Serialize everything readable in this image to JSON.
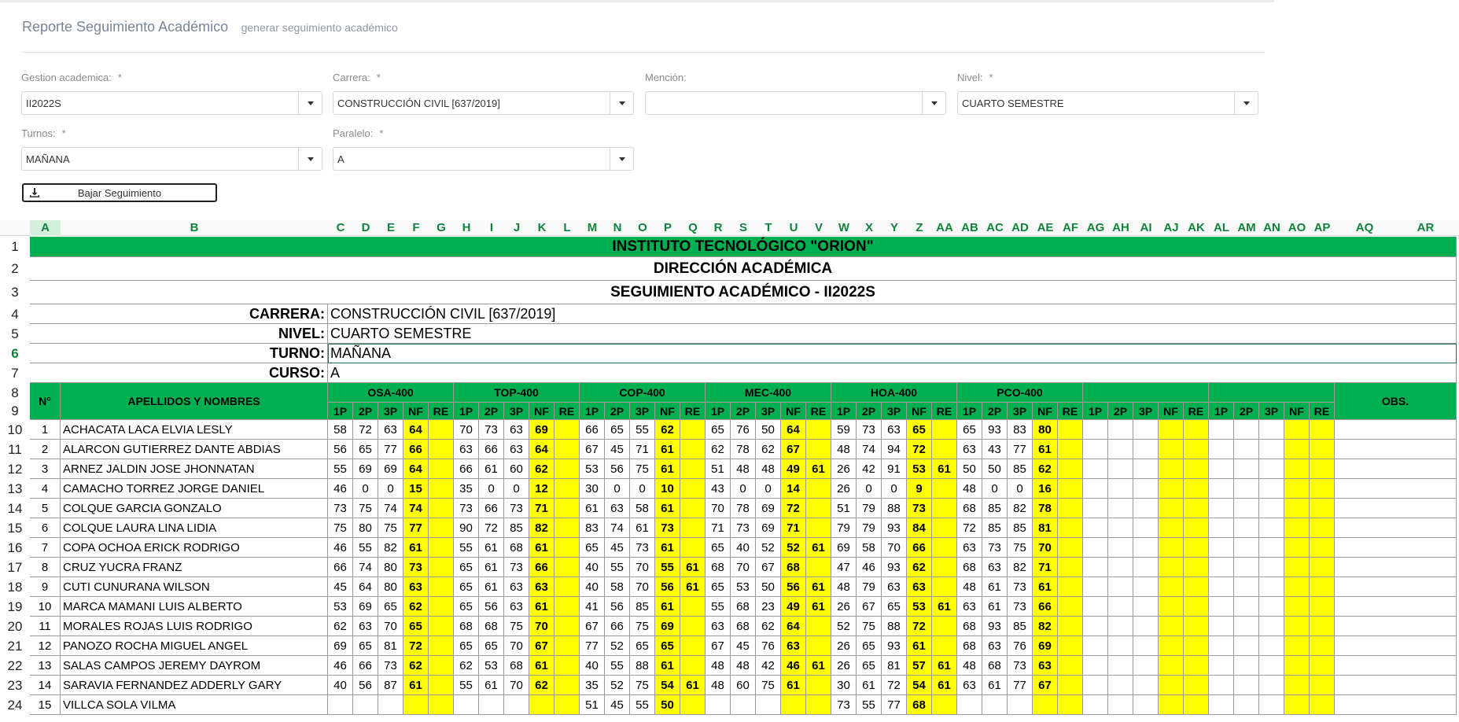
{
  "header": {
    "title": "Reporte Seguimiento Académico",
    "subtitle": "generar seguimiento académico"
  },
  "filters": {
    "gestion": {
      "label": "Gestion academica:",
      "required": "*",
      "value": "II2022S"
    },
    "carrera": {
      "label": "Carrera:",
      "required": "*",
      "value": "CONSTRUCCIÓN CIVIL [637/2019]"
    },
    "mencion": {
      "label": "Mención:",
      "required": "",
      "value": ""
    },
    "nivel": {
      "label": "Nivel:",
      "required": "*",
      "value": "CUARTO SEMESTRE"
    },
    "turnos": {
      "label": "Turnos:",
      "required": "*",
      "value": "MAÑANA"
    },
    "paralelo": {
      "label": "Paralelo:",
      "required": "*",
      "value": "A"
    }
  },
  "download_button": {
    "label": "Bajar Seguimiento",
    "icon": "download-icon"
  },
  "colors": {
    "green": "#00b050",
    "yellow": "#ffff00",
    "header_text": "#11823b"
  },
  "sheet": {
    "column_letters": [
      "A",
      "B",
      "C",
      "D",
      "E",
      "F",
      "G",
      "H",
      "I",
      "J",
      "K",
      "L",
      "M",
      "N",
      "O",
      "P",
      "Q",
      "R",
      "S",
      "T",
      "U",
      "V",
      "W",
      "X",
      "Y",
      "Z",
      "AA",
      "AB",
      "AC",
      "AD",
      "AE",
      "AF",
      "AG",
      "AH",
      "AI",
      "AJ",
      "AK",
      "AL",
      "AM",
      "AN",
      "AO",
      "AP",
      "AQ",
      "AR"
    ],
    "row_numbers": [
      "1",
      "2",
      "3",
      "4",
      "5",
      "6",
      "7",
      "8",
      "9",
      "10",
      "11",
      "12",
      "13",
      "14",
      "15",
      "16",
      "17",
      "18",
      "19",
      "20",
      "21",
      "22",
      "23",
      "24"
    ],
    "title1": "INSTITUTO TECNOLÓGICO  \"ORION\"",
    "title2": "DIRECCIÓN ACADÉMICA",
    "title3": "SEGUIMIENTO ACADÉMICO - II2022S",
    "info": [
      {
        "label": "CARRERA:",
        "value": "CONSTRUCCIÓN CIVIL [637/2019]"
      },
      {
        "label": "NIVEL:",
        "value": "CUARTO SEMESTRE"
      },
      {
        "label": "TURNO:",
        "value": "MAÑANA"
      },
      {
        "label": "CURSO:",
        "value": "A"
      }
    ],
    "col_no": "N°",
    "col_name": "APELLIDOS Y NOMBRES",
    "col_obs": "OBS.",
    "subjects": [
      "OSA-400",
      "TOP-400",
      "COP-400",
      "MEC-400",
      "HOA-400",
      "PCO-400",
      "",
      ""
    ],
    "sub_columns": [
      "1P",
      "2P",
      "3P",
      "NF",
      "RE"
    ],
    "students": [
      {
        "n": "1",
        "name": "ACHACATA LACA ELVIA LESLY",
        "g": [
          [
            "58",
            "72",
            "63",
            "64",
            ""
          ],
          [
            "70",
            "73",
            "63",
            "69",
            ""
          ],
          [
            "66",
            "65",
            "55",
            "62",
            ""
          ],
          [
            "65",
            "76",
            "50",
            "64",
            ""
          ],
          [
            "59",
            "73",
            "63",
            "65",
            ""
          ],
          [
            "65",
            "93",
            "83",
            "80",
            ""
          ]
        ]
      },
      {
        "n": "2",
        "name": "ALARCON GUTIERREZ DANTE ABDIAS",
        "g": [
          [
            "56",
            "65",
            "77",
            "66",
            ""
          ],
          [
            "63",
            "66",
            "63",
            "64",
            ""
          ],
          [
            "67",
            "45",
            "71",
            "61",
            ""
          ],
          [
            "62",
            "78",
            "62",
            "67",
            ""
          ],
          [
            "48",
            "74",
            "94",
            "72",
            ""
          ],
          [
            "63",
            "43",
            "77",
            "61",
            ""
          ]
        ]
      },
      {
        "n": "3",
        "name": "ARNEZ JALDIN JOSE JHONNATAN",
        "g": [
          [
            "55",
            "69",
            "69",
            "64",
            ""
          ],
          [
            "66",
            "61",
            "60",
            "62",
            ""
          ],
          [
            "53",
            "56",
            "75",
            "61",
            ""
          ],
          [
            "51",
            "48",
            "48",
            "49",
            "61"
          ],
          [
            "26",
            "42",
            "91",
            "53",
            "61"
          ],
          [
            "50",
            "50",
            "85",
            "62",
            ""
          ]
        ]
      },
      {
        "n": "4",
        "name": "CAMACHO TORREZ JORGE DANIEL",
        "g": [
          [
            "46",
            "0",
            "0",
            "15",
            ""
          ],
          [
            "35",
            "0",
            "0",
            "12",
            ""
          ],
          [
            "30",
            "0",
            "0",
            "10",
            ""
          ],
          [
            "43",
            "0",
            "0",
            "14",
            ""
          ],
          [
            "26",
            "0",
            "0",
            "9",
            ""
          ],
          [
            "48",
            "0",
            "0",
            "16",
            ""
          ]
        ]
      },
      {
        "n": "5",
        "name": "COLQUE GARCIA GONZALO",
        "g": [
          [
            "73",
            "75",
            "74",
            "74",
            ""
          ],
          [
            "73",
            "66",
            "73",
            "71",
            ""
          ],
          [
            "61",
            "63",
            "58",
            "61",
            ""
          ],
          [
            "70",
            "78",
            "69",
            "72",
            ""
          ],
          [
            "51",
            "79",
            "88",
            "73",
            ""
          ],
          [
            "68",
            "85",
            "82",
            "78",
            ""
          ]
        ]
      },
      {
        "n": "6",
        "name": "COLQUE LAURA LINA LIDIA",
        "g": [
          [
            "75",
            "80",
            "75",
            "77",
            ""
          ],
          [
            "90",
            "72",
            "85",
            "82",
            ""
          ],
          [
            "83",
            "74",
            "61",
            "73",
            ""
          ],
          [
            "71",
            "73",
            "69",
            "71",
            ""
          ],
          [
            "79",
            "79",
            "93",
            "84",
            ""
          ],
          [
            "72",
            "85",
            "85",
            "81",
            ""
          ]
        ]
      },
      {
        "n": "7",
        "name": "COPA OCHOA ERICK RODRIGO",
        "g": [
          [
            "46",
            "55",
            "82",
            "61",
            ""
          ],
          [
            "55",
            "61",
            "68",
            "61",
            ""
          ],
          [
            "65",
            "45",
            "73",
            "61",
            ""
          ],
          [
            "65",
            "40",
            "52",
            "52",
            "61"
          ],
          [
            "69",
            "58",
            "70",
            "66",
            ""
          ],
          [
            "63",
            "73",
            "75",
            "70",
            ""
          ]
        ]
      },
      {
        "n": "8",
        "name": "CRUZ YUCRA FRANZ",
        "g": [
          [
            "66",
            "74",
            "80",
            "73",
            ""
          ],
          [
            "65",
            "61",
            "73",
            "66",
            ""
          ],
          [
            "40",
            "55",
            "70",
            "55",
            "61"
          ],
          [
            "68",
            "70",
            "67",
            "68",
            ""
          ],
          [
            "47",
            "46",
            "93",
            "62",
            ""
          ],
          [
            "68",
            "63",
            "82",
            "71",
            ""
          ]
        ]
      },
      {
        "n": "9",
        "name": "CUTI CUNURANA WILSON",
        "g": [
          [
            "45",
            "64",
            "80",
            "63",
            ""
          ],
          [
            "65",
            "61",
            "63",
            "63",
            ""
          ],
          [
            "40",
            "58",
            "70",
            "56",
            "61"
          ],
          [
            "65",
            "53",
            "50",
            "56",
            "61"
          ],
          [
            "48",
            "79",
            "63",
            "63",
            ""
          ],
          [
            "48",
            "61",
            "73",
            "61",
            ""
          ]
        ]
      },
      {
        "n": "10",
        "name": "MARCA MAMANI LUIS ALBERTO",
        "g": [
          [
            "53",
            "69",
            "65",
            "62",
            ""
          ],
          [
            "65",
            "56",
            "63",
            "61",
            ""
          ],
          [
            "41",
            "56",
            "85",
            "61",
            ""
          ],
          [
            "55",
            "68",
            "23",
            "49",
            "61"
          ],
          [
            "26",
            "67",
            "65",
            "53",
            "61"
          ],
          [
            "63",
            "61",
            "73",
            "66",
            ""
          ]
        ]
      },
      {
        "n": "11",
        "name": "MORALES ROJAS LUIS RODRIGO",
        "g": [
          [
            "62",
            "63",
            "70",
            "65",
            ""
          ],
          [
            "68",
            "68",
            "75",
            "70",
            ""
          ],
          [
            "67",
            "66",
            "75",
            "69",
            ""
          ],
          [
            "63",
            "68",
            "62",
            "64",
            ""
          ],
          [
            "52",
            "75",
            "88",
            "72",
            ""
          ],
          [
            "68",
            "93",
            "85",
            "82",
            ""
          ]
        ]
      },
      {
        "n": "12",
        "name": "PANOZO ROCHA MIGUEL ANGEL",
        "g": [
          [
            "69",
            "65",
            "81",
            "72",
            ""
          ],
          [
            "65",
            "65",
            "70",
            "67",
            ""
          ],
          [
            "77",
            "52",
            "65",
            "65",
            ""
          ],
          [
            "67",
            "45",
            "76",
            "63",
            ""
          ],
          [
            "26",
            "65",
            "93",
            "61",
            ""
          ],
          [
            "68",
            "63",
            "76",
            "69",
            ""
          ]
        ]
      },
      {
        "n": "13",
        "name": "SALAS CAMPOS JEREMY DAYROM",
        "g": [
          [
            "46",
            "66",
            "73",
            "62",
            ""
          ],
          [
            "62",
            "53",
            "68",
            "61",
            ""
          ],
          [
            "40",
            "55",
            "88",
            "61",
            ""
          ],
          [
            "48",
            "48",
            "42",
            "46",
            "61"
          ],
          [
            "26",
            "65",
            "81",
            "57",
            "61"
          ],
          [
            "48",
            "68",
            "73",
            "63",
            ""
          ]
        ]
      },
      {
        "n": "14",
        "name": "SARAVIA FERNANDEZ ADDERLY GARY",
        "g": [
          [
            "40",
            "56",
            "87",
            "61",
            ""
          ],
          [
            "55",
            "61",
            "70",
            "62",
            ""
          ],
          [
            "35",
            "52",
            "75",
            "54",
            "61"
          ],
          [
            "48",
            "60",
            "75",
            "61",
            ""
          ],
          [
            "30",
            "61",
            "72",
            "54",
            "61"
          ],
          [
            "63",
            "61",
            "77",
            "67",
            ""
          ]
        ]
      },
      {
        "n": "15",
        "name": "VILLCA  SOLA VILMA",
        "g": [
          [
            "",
            "",
            "",
            "",
            ""
          ],
          [
            "",
            "",
            "",
            "",
            ""
          ],
          [
            "51",
            "45",
            "55",
            "50",
            ""
          ],
          [
            "",
            "",
            "",
            "",
            ""
          ],
          [
            "73",
            "55",
            "77",
            "68",
            ""
          ],
          [
            "",
            "",
            "",
            "",
            ""
          ]
        ]
      }
    ]
  }
}
